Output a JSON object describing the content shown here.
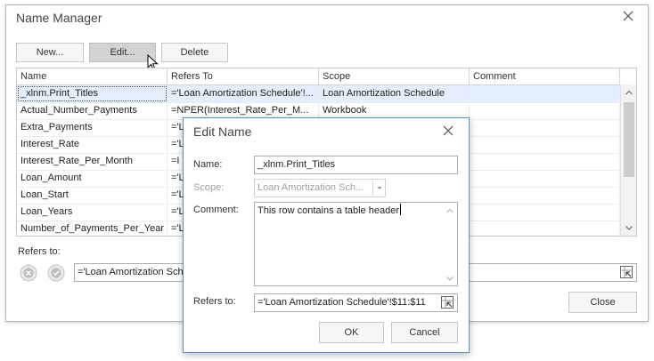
{
  "main": {
    "title": "Name Manager",
    "buttons": {
      "new": "New...",
      "edit": "Edit...",
      "delete": "Delete"
    },
    "columns": [
      "Name",
      "Refers To",
      "Scope",
      "Comment"
    ],
    "rows": [
      {
        "name": "_xlnm.Print_Titles",
        "refers_to": "='Loan Amortization Schedule'!...",
        "scope": "Loan Amortization Schedule",
        "comment": ""
      },
      {
        "name": "Actual_Number_Payments",
        "refers_to": "=NPER(Interest_Rate_Per_M...",
        "scope": "Workbook",
        "comment": ""
      },
      {
        "name": "Extra_Payments",
        "refers_to": "='L",
        "scope": "",
        "comment": ""
      },
      {
        "name": "Interest_Rate",
        "refers_to": "='L",
        "scope": "",
        "comment": ""
      },
      {
        "name": "Interest_Rate_Per_Month",
        "refers_to": "=I",
        "scope": "",
        "comment": ""
      },
      {
        "name": "Loan_Amount",
        "refers_to": "='L",
        "scope": "",
        "comment": ""
      },
      {
        "name": "Loan_Start",
        "refers_to": "='L",
        "scope": "",
        "comment": ""
      },
      {
        "name": "Loan_Years",
        "refers_to": "='L",
        "scope": "",
        "comment": ""
      },
      {
        "name": "Number_of_Payments_Per_Year",
        "refers_to": "='L",
        "scope": "",
        "comment": ""
      }
    ],
    "refers_to_label": "Refers to:",
    "refers_to_value": "='Loan Amortization Sche",
    "close_label": "Close"
  },
  "dialog": {
    "title": "Edit Name",
    "name_label": "Name:",
    "name_value": "_xlnm.Print_Titles",
    "scope_label": "Scope:",
    "scope_value": "Loan Amortization Sch...",
    "comment_label": "Comment:",
    "comment_value": "This row contains a table header",
    "refers_label": "Refers to:",
    "refers_value": "='Loan Amortization Schedule'!$11:$11",
    "ok_label": "OK",
    "cancel_label": "Cancel"
  },
  "colors": {
    "dialog_border": "#5b8fc9",
    "selection": "#e4eefc"
  },
  "icons": [
    "close-icon",
    "cancel-formula-icon",
    "confirm-formula-icon",
    "range-select-icon",
    "mouse-cursor-icon",
    "chevron-up-icon",
    "chevron-down-icon"
  ]
}
